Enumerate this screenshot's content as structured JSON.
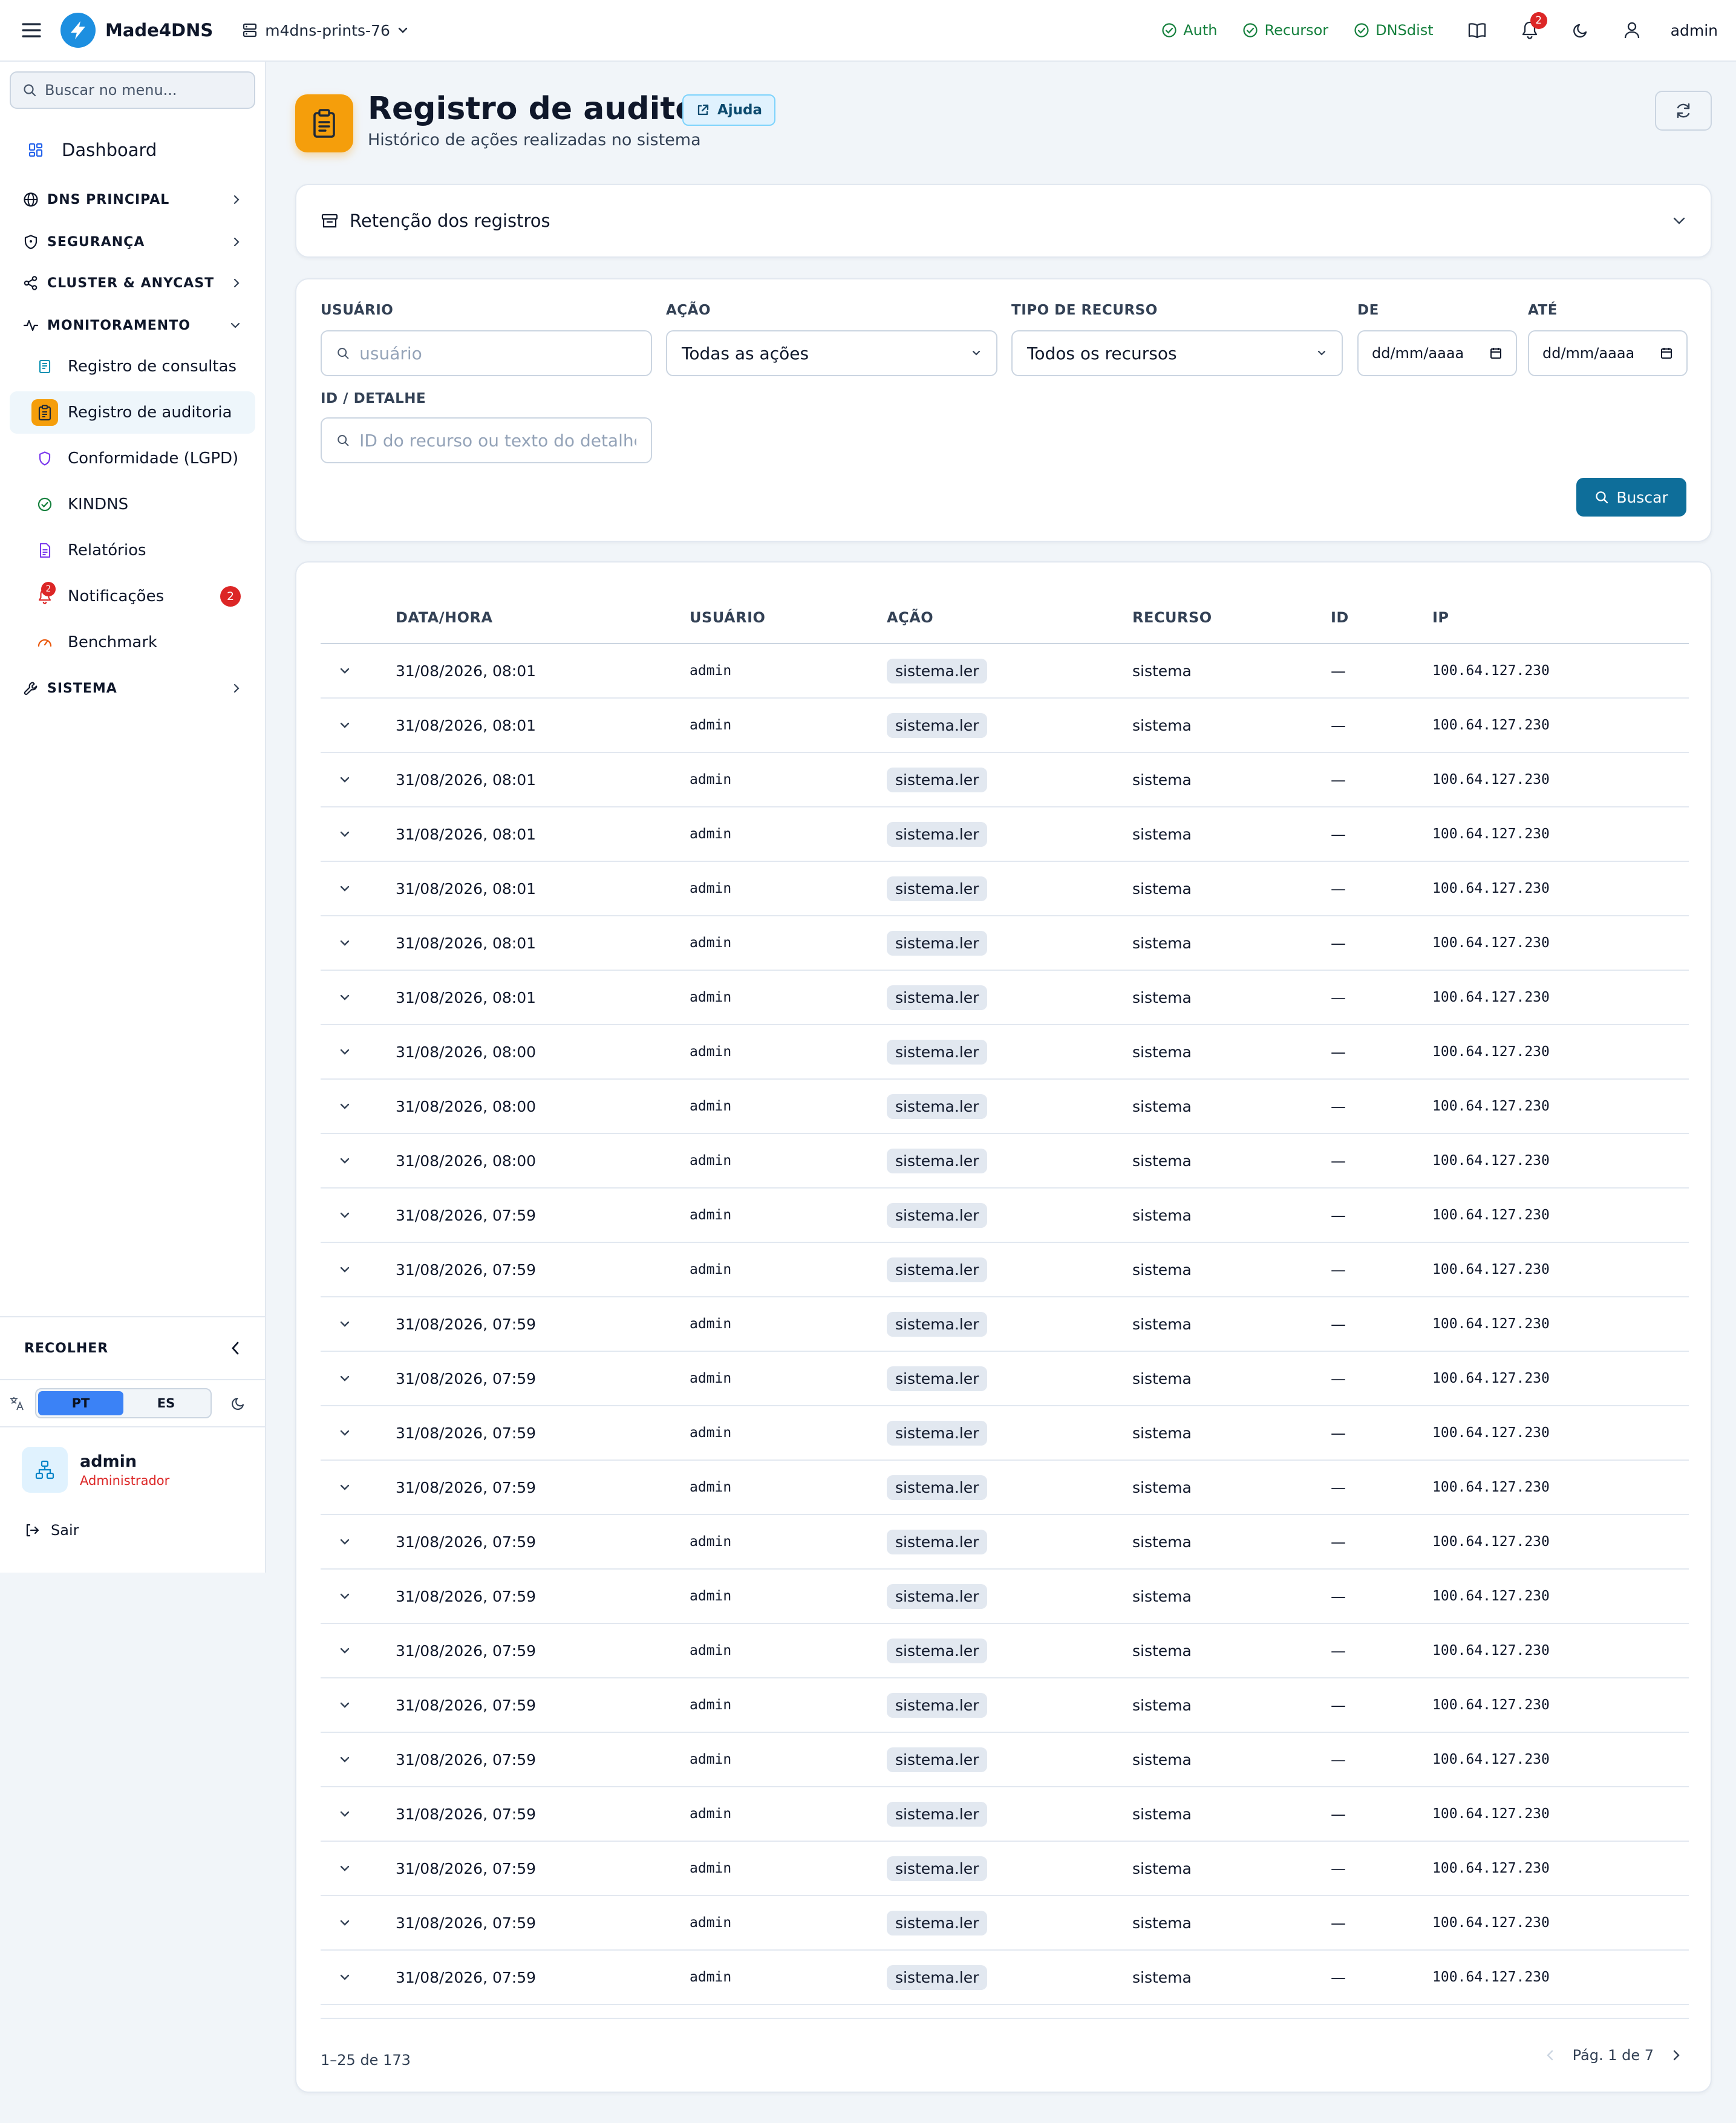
{
  "topbar": {
    "app_name": "Made4DNS",
    "server": "m4dns-prints-76",
    "services": [
      {
        "name": "Auth",
        "status": "ok"
      },
      {
        "name": "Recursor",
        "status": "ok"
      },
      {
        "name": "DNSdist",
        "status": "ok"
      }
    ],
    "notification_count": "2",
    "username": "admin"
  },
  "sidebar": {
    "search_placeholder": "Buscar no menu...",
    "dashboard": "Dashboard",
    "groups": {
      "dns": "DNS PRINCIPAL",
      "security": "SEGURANÇA",
      "cluster": "CLUSTER & ANYCAST",
      "monitoring": "MONITORAMENTO",
      "system": "SISTEMA"
    },
    "monitoring_items": [
      {
        "label": "Registro de consultas",
        "icon": "query-log-icon"
      },
      {
        "label": "Registro de auditoria",
        "icon": "clipboard-icon",
        "active": true
      },
      {
        "label": "Conformidade (LGPD)",
        "icon": "shield-icon"
      },
      {
        "label": "KINDNS",
        "icon": "check-circle-icon"
      },
      {
        "label": "Relatórios",
        "icon": "document-icon"
      },
      {
        "label": "Notificações",
        "icon": "bell-icon",
        "badge": "2"
      },
      {
        "label": "Benchmark",
        "icon": "gauge-icon"
      }
    ],
    "collapse_label": "RECOLHER",
    "languages": [
      "PT",
      "ES"
    ],
    "active_language": "PT",
    "user": {
      "name": "admin",
      "role": "Administrador"
    },
    "logout": "Sair"
  },
  "page": {
    "title": "Registro de auditoria",
    "help_label": "Ajuda",
    "subtitle": "Histórico de ações realizadas no sistema",
    "retention_label": "Retenção dos registros"
  },
  "filters": {
    "user_label": "USUÁRIO",
    "user_placeholder": "usuário",
    "action_label": "AÇÃO",
    "action_value": "Todas as ações",
    "resource_label": "TIPO DE RECURSO",
    "resource_value": "Todos os recursos",
    "from_label": "DE",
    "from_placeholder": "dd/mm/aaaa",
    "to_label": "ATÉ",
    "to_placeholder": "dd/mm/aaaa",
    "detail_label": "ID / DETALHE",
    "detail_placeholder": "ID do recurso ou texto do detalhe",
    "search_button": "Buscar"
  },
  "table": {
    "columns": [
      "DATA/HORA",
      "USUÁRIO",
      "AÇÃO",
      "RECURSO",
      "ID",
      "IP"
    ],
    "rows": [
      [
        "31/08/2026, 08:01",
        "admin",
        "sistema.ler",
        "sistema",
        "—",
        "100.64.127.230"
      ],
      [
        "31/08/2026, 08:01",
        "admin",
        "sistema.ler",
        "sistema",
        "—",
        "100.64.127.230"
      ],
      [
        "31/08/2026, 08:01",
        "admin",
        "sistema.ler",
        "sistema",
        "—",
        "100.64.127.230"
      ],
      [
        "31/08/2026, 08:01",
        "admin",
        "sistema.ler",
        "sistema",
        "—",
        "100.64.127.230"
      ],
      [
        "31/08/2026, 08:01",
        "admin",
        "sistema.ler",
        "sistema",
        "—",
        "100.64.127.230"
      ],
      [
        "31/08/2026, 08:01",
        "admin",
        "sistema.ler",
        "sistema",
        "—",
        "100.64.127.230"
      ],
      [
        "31/08/2026, 08:01",
        "admin",
        "sistema.ler",
        "sistema",
        "—",
        "100.64.127.230"
      ],
      [
        "31/08/2026, 08:00",
        "admin",
        "sistema.ler",
        "sistema",
        "—",
        "100.64.127.230"
      ],
      [
        "31/08/2026, 08:00",
        "admin",
        "sistema.ler",
        "sistema",
        "—",
        "100.64.127.230"
      ],
      [
        "31/08/2026, 08:00",
        "admin",
        "sistema.ler",
        "sistema",
        "—",
        "100.64.127.230"
      ],
      [
        "31/08/2026, 07:59",
        "admin",
        "sistema.ler",
        "sistema",
        "—",
        "100.64.127.230"
      ],
      [
        "31/08/2026, 07:59",
        "admin",
        "sistema.ler",
        "sistema",
        "—",
        "100.64.127.230"
      ],
      [
        "31/08/2026, 07:59",
        "admin",
        "sistema.ler",
        "sistema",
        "—",
        "100.64.127.230"
      ],
      [
        "31/08/2026, 07:59",
        "admin",
        "sistema.ler",
        "sistema",
        "—",
        "100.64.127.230"
      ],
      [
        "31/08/2026, 07:59",
        "admin",
        "sistema.ler",
        "sistema",
        "—",
        "100.64.127.230"
      ],
      [
        "31/08/2026, 07:59",
        "admin",
        "sistema.ler",
        "sistema",
        "—",
        "100.64.127.230"
      ],
      [
        "31/08/2026, 07:59",
        "admin",
        "sistema.ler",
        "sistema",
        "—",
        "100.64.127.230"
      ],
      [
        "31/08/2026, 07:59",
        "admin",
        "sistema.ler",
        "sistema",
        "—",
        "100.64.127.230"
      ],
      [
        "31/08/2026, 07:59",
        "admin",
        "sistema.ler",
        "sistema",
        "—",
        "100.64.127.230"
      ],
      [
        "31/08/2026, 07:59",
        "admin",
        "sistema.ler",
        "sistema",
        "—",
        "100.64.127.230"
      ],
      [
        "31/08/2026, 07:59",
        "admin",
        "sistema.ler",
        "sistema",
        "—",
        "100.64.127.230"
      ],
      [
        "31/08/2026, 07:59",
        "admin",
        "sistema.ler",
        "sistema",
        "—",
        "100.64.127.230"
      ],
      [
        "31/08/2026, 07:59",
        "admin",
        "sistema.ler",
        "sistema",
        "—",
        "100.64.127.230"
      ],
      [
        "31/08/2026, 07:59",
        "admin",
        "sistema.ler",
        "sistema",
        "—",
        "100.64.127.230"
      ],
      [
        "31/08/2026, 07:59",
        "admin",
        "sistema.ler",
        "sistema",
        "—",
        "100.64.127.230"
      ]
    ],
    "range_text": "1–25 de 173",
    "page_text": "Pág. 1 de 7"
  }
}
